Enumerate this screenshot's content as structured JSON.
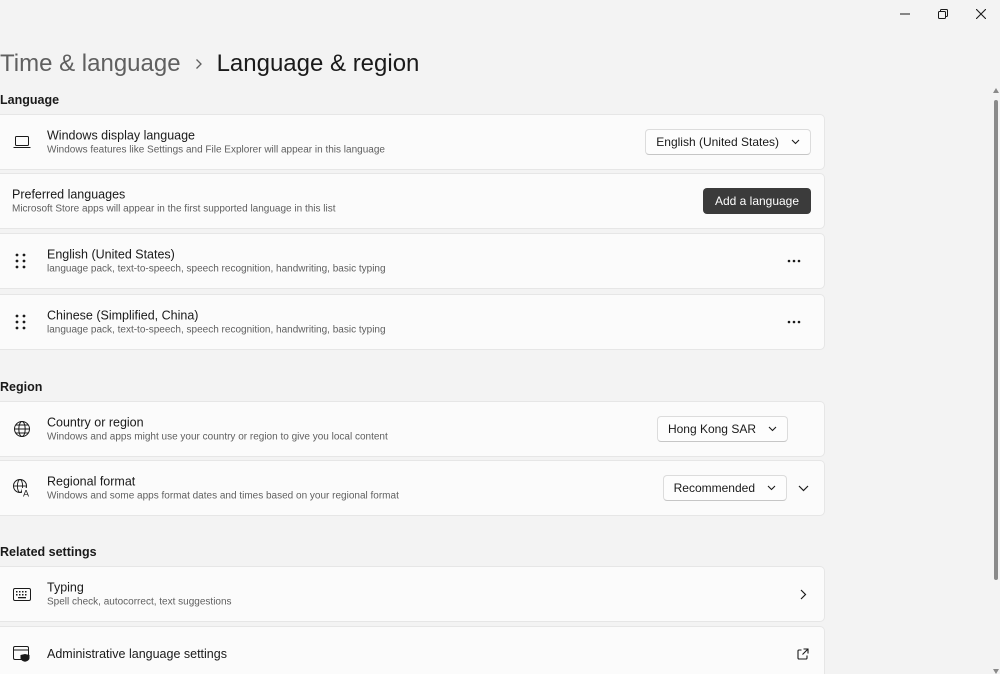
{
  "window": {
    "minimize_icon": "minimize-icon",
    "restore_icon": "restore-icon",
    "close_icon": "close-icon"
  },
  "breadcrumb": {
    "parent": "Time & language",
    "separator_icon": "chevron-right-icon",
    "current": "Language & region"
  },
  "language_section": {
    "title": "Language",
    "display_language": {
      "icon": "laptop-icon",
      "title": "Windows display language",
      "subtitle": "Windows features like Settings and File Explorer will appear in this language",
      "selected": "English (United States)"
    },
    "preferred": {
      "title": "Preferred languages",
      "subtitle": "Microsoft Store apps will appear in the first supported language in this list",
      "add_button": "Add a language"
    },
    "languages": [
      {
        "name": "English (United States)",
        "features": "language pack, text-to-speech, speech recognition, handwriting, basic typing"
      },
      {
        "name": "Chinese (Simplified, China)",
        "features": "language pack, text-to-speech, speech recognition, handwriting, basic typing"
      }
    ]
  },
  "region_section": {
    "title": "Region",
    "country": {
      "icon": "globe-icon",
      "title": "Country or region",
      "subtitle": "Windows and apps might use your country or region to give you local content",
      "selected": "Hong Kong SAR"
    },
    "format": {
      "icon": "regional-format-icon",
      "title": "Regional format",
      "subtitle": "Windows and some apps format dates and times based on your regional format",
      "selected": "Recommended"
    }
  },
  "related_section": {
    "title": "Related settings",
    "typing": {
      "icon": "keyboard-icon",
      "title": "Typing",
      "subtitle": "Spell check, autocorrect, text suggestions"
    },
    "admin": {
      "icon": "admin-settings-icon",
      "title": "Administrative language settings",
      "link_icon": "external-link-icon"
    }
  },
  "colors": {
    "background": "#f3f3f3",
    "card": "#fbfbfb",
    "primary_button": "#3b3b3b"
  }
}
